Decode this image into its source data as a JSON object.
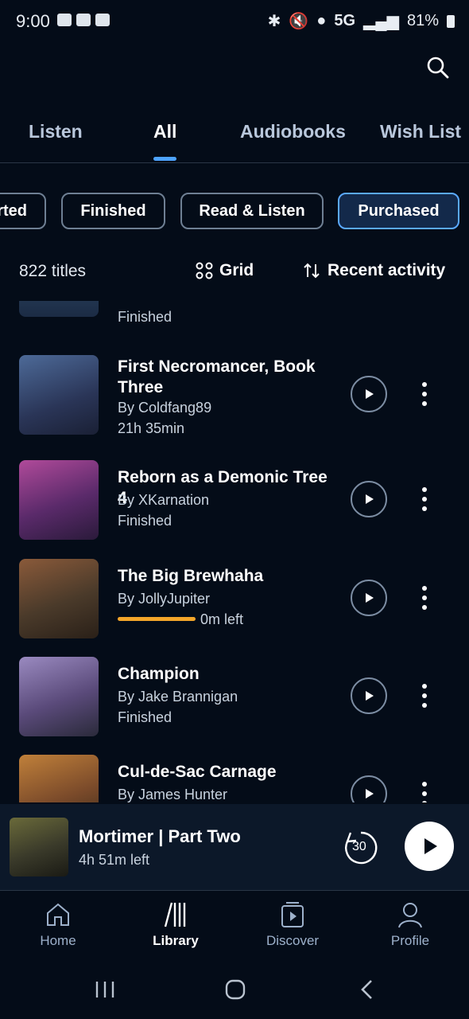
{
  "status_bar": {
    "time": "9:00",
    "network": "5G",
    "battery": "81%"
  },
  "tabs": [
    {
      "label": "Listen"
    },
    {
      "label": "All"
    },
    {
      "label": "Audiobooks"
    },
    {
      "label": "Wish List"
    }
  ],
  "chips": [
    {
      "label": "Started"
    },
    {
      "label": "Finished"
    },
    {
      "label": "Read & Listen"
    },
    {
      "label": "Purchased"
    }
  ],
  "summary": {
    "count": "822 titles",
    "view_label": "Grid",
    "sort_label": "Recent activity"
  },
  "partial_item": {
    "status": "Finished"
  },
  "items": [
    {
      "title": "First Necromancer, Book Three",
      "author": "By Coldfang89",
      "meta": "21h 35min",
      "cover_color": "#3a4f7a"
    },
    {
      "title": "Reborn as a Demonic Tree 4",
      "author": "By XKarnation",
      "meta": "Finished",
      "cover_color": "#7a3a8a"
    },
    {
      "title": "The Big Brewhaha",
      "author": "By JollyJupiter",
      "meta": "0m left",
      "progress": 1.0,
      "cover_color": "#5a3a2a"
    },
    {
      "title": "Champion",
      "author": "By Jake Brannigan",
      "meta": "Finished",
      "cover_color": "#6a5a8a"
    },
    {
      "title": "Cul-de-Sac Carnage",
      "author": "By James Hunter",
      "meta": "",
      "cover_color": "#8a4a2a"
    }
  ],
  "mini_player": {
    "title": "Mortimer | Part Two",
    "subtitle": "4h 51m left",
    "skip_seconds": "30"
  },
  "nav": [
    {
      "label": "Home"
    },
    {
      "label": "Library"
    },
    {
      "label": "Discover"
    },
    {
      "label": "Profile"
    }
  ],
  "colors": {
    "background": "#040c18",
    "accent": "#4da3ff",
    "progress": "#f4a62a"
  }
}
